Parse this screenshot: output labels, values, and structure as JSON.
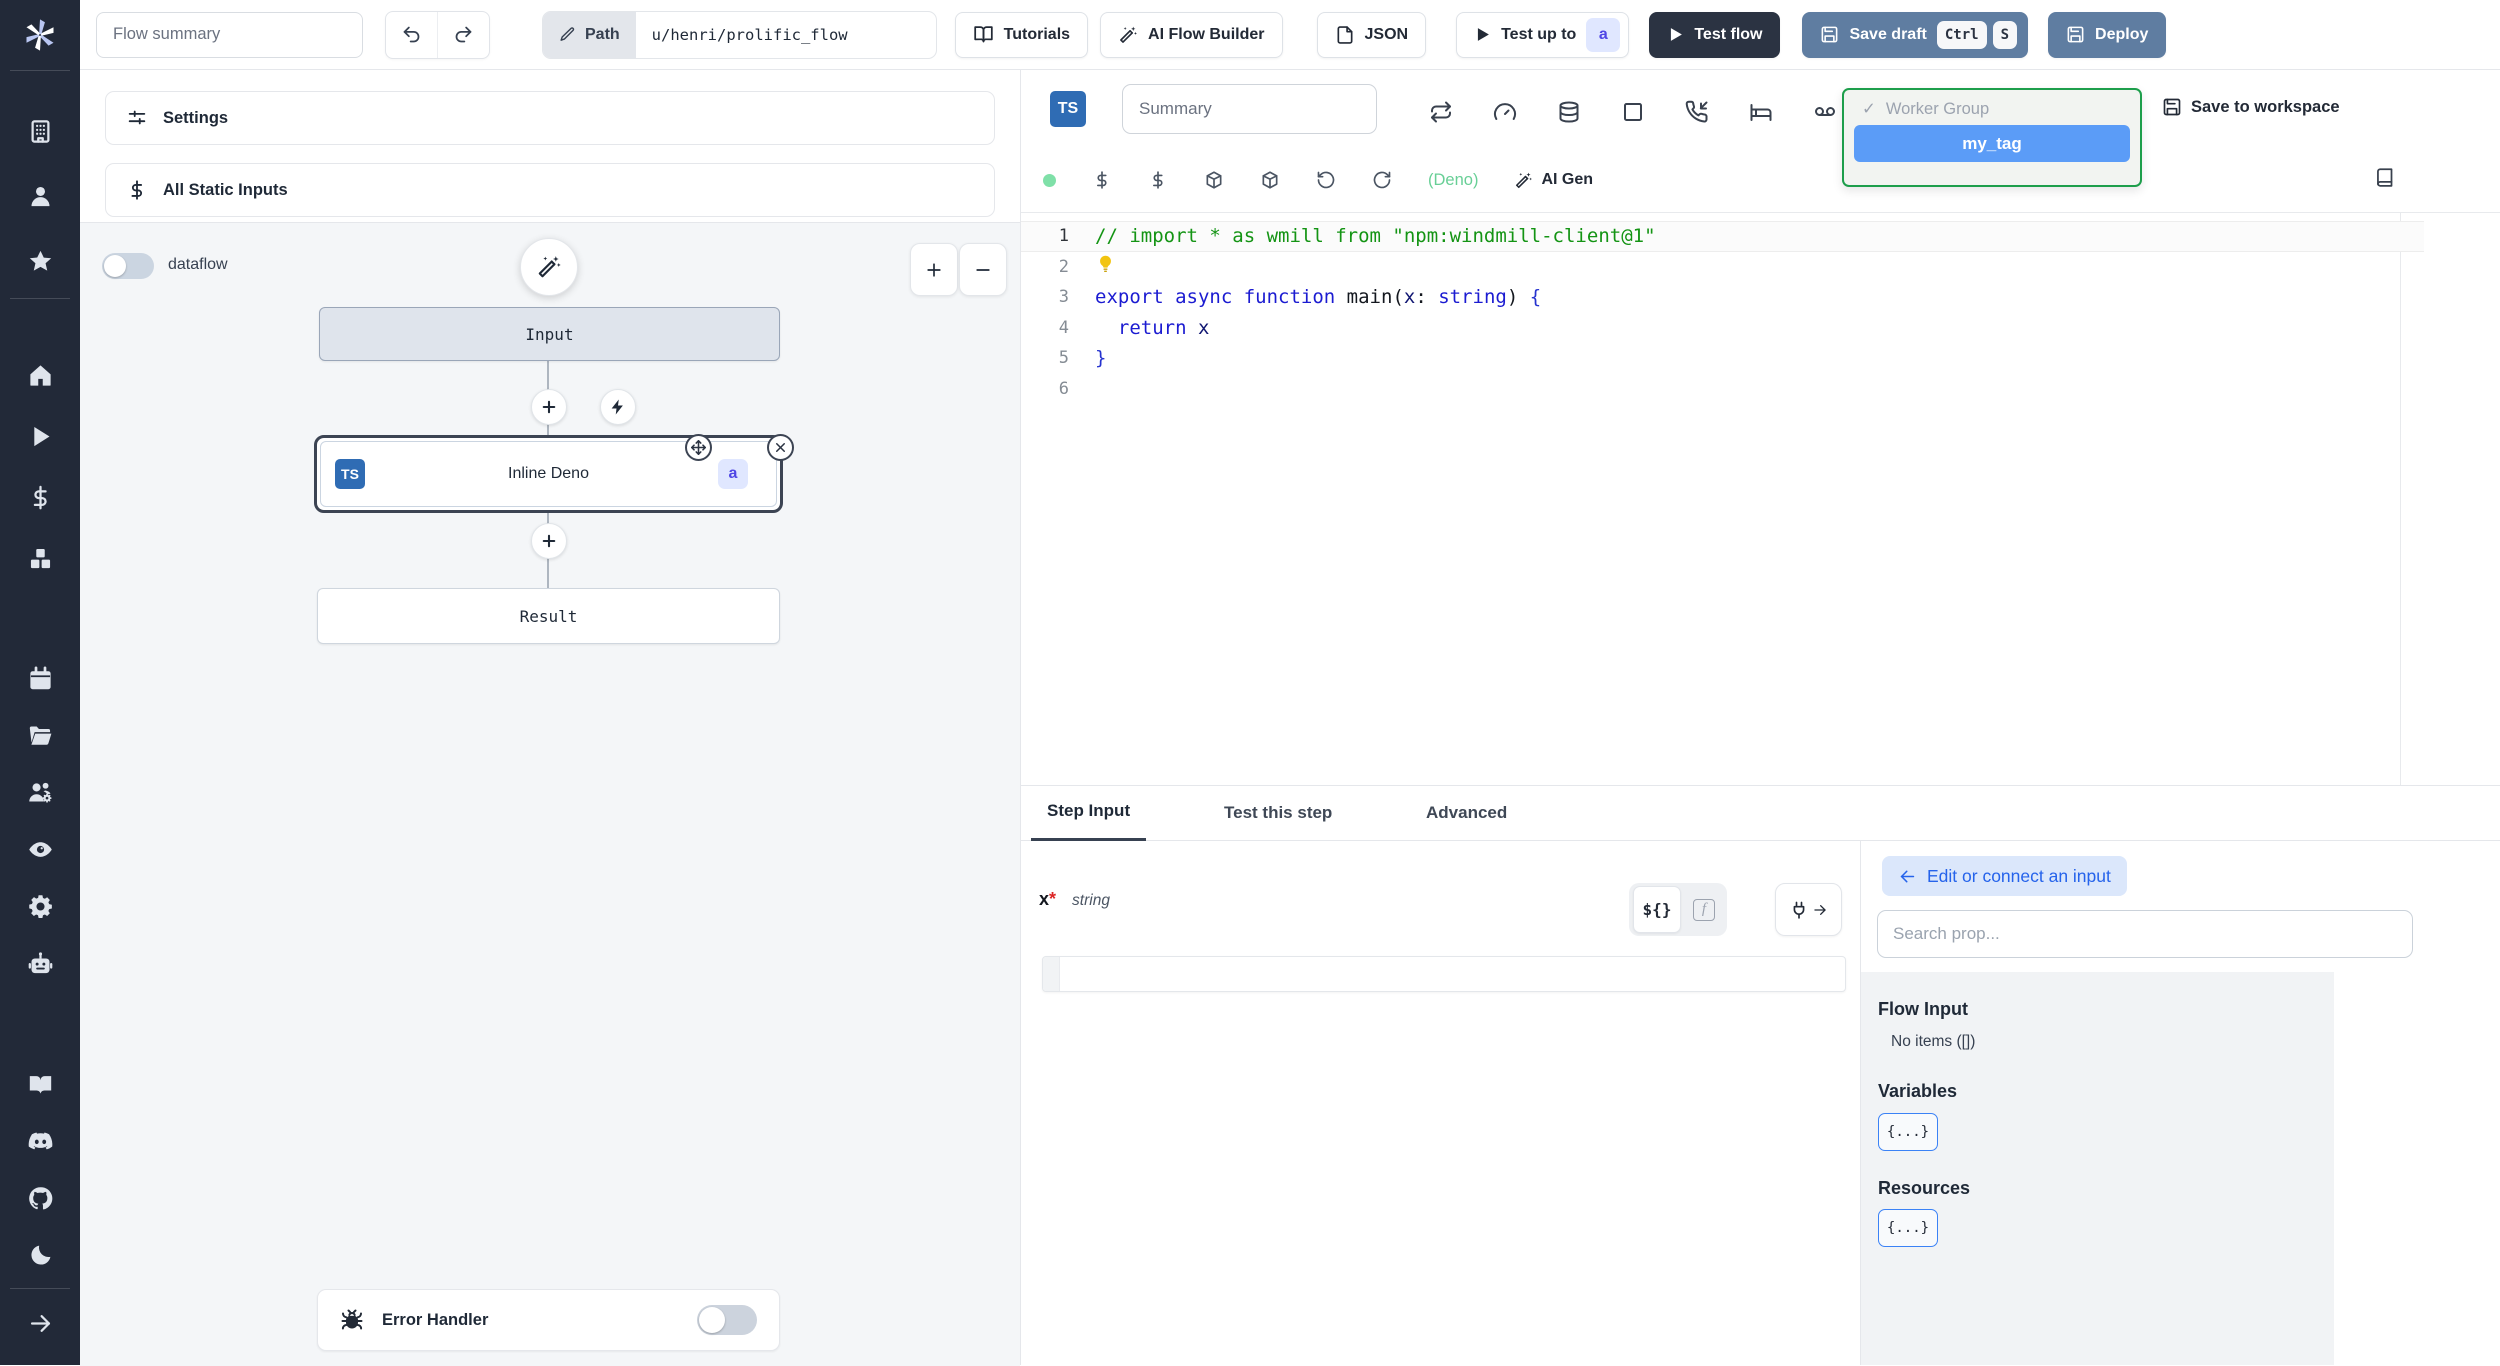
{
  "colors": {
    "sidebar_bg": "#222938",
    "button_slate": "#5f7da1",
    "button_dark": "#2b3342",
    "ts_blue": "#2f6cb4",
    "badge_indigo_bg": "#e0e7ff",
    "badge_indigo_text": "#4f46e5",
    "dropdown_green": "#1d9e4b",
    "tag_selected_bg": "#5b9cf7",
    "accent_blue": "#2563eb"
  },
  "topbar": {
    "flow_summary_placeholder": "Flow summary",
    "path_label": "Path",
    "path_value": "u/henri/prolific_flow",
    "tutorials": "Tutorials",
    "ai_flow_builder": "AI Flow Builder",
    "json": "JSON",
    "test_up_to": "Test up to",
    "test_up_to_badge": "a",
    "test_flow": "Test flow",
    "save_draft": "Save draft",
    "kbd_ctrl": "Ctrl",
    "kbd_s": "S",
    "deploy": "Deploy"
  },
  "sidebar": {
    "groups": [
      {
        "id": "account",
        "items": [
          "building",
          "user",
          "star"
        ]
      },
      {
        "id": "primary",
        "items": [
          "home",
          "play",
          "dollar",
          "boxes"
        ]
      },
      {
        "id": "workspace",
        "items": [
          "calendar",
          "folder-open",
          "users-cog",
          "eye",
          "gear",
          "bot"
        ]
      },
      {
        "id": "help",
        "items": [
          "docs",
          "discord",
          "github",
          "moon"
        ]
      },
      {
        "id": "footer",
        "items": [
          "arrow-right"
        ]
      }
    ]
  },
  "flow_panel": {
    "settings_label": "Settings",
    "static_inputs_label": "All Static Inputs",
    "dataflow_label": "dataflow",
    "input_node": "Input",
    "step_node_label": "Inline Deno",
    "step_node_lang_badge": "TS",
    "step_node_id_badge": "a",
    "result_node": "Result",
    "error_handler_label": "Error Handler"
  },
  "editor_panel": {
    "lang_badge": "TS",
    "summary_placeholder": "Summary",
    "step_setting_icons": [
      "repeat",
      "gauge",
      "database",
      "square",
      "phone-incoming",
      "bed",
      "voicemail"
    ],
    "quick_icons": [
      "dollar",
      "dollar",
      "box",
      "box",
      "rotate-ccw",
      "refresh-cw"
    ],
    "deno_label": "(Deno)",
    "ai_gen_label": "AI Gen",
    "worker_group": {
      "check": "✓",
      "label": "Worker Group",
      "options": [
        "my_tag"
      ],
      "selected_option": "my_tag"
    },
    "save_to_workspace": "Save to workspace",
    "code": {
      "lines": [
        {
          "num": "1",
          "highlight": true,
          "tokens": [
            [
              "// import * as wmill from \"npm:windmill-client@1\"",
              "comment"
            ]
          ]
        },
        {
          "num": "2",
          "bulb": true,
          "tokens": []
        },
        {
          "num": "3",
          "tokens": [
            [
              "export ",
              "kw"
            ],
            [
              "async ",
              "kw"
            ],
            [
              "function ",
              "kw"
            ],
            [
              "main",
              "fn"
            ],
            [
              "(",
              "pu"
            ],
            [
              "x",
              "vr"
            ],
            [
              ": ",
              "pu"
            ],
            [
              "string",
              "kw"
            ],
            [
              ")",
              "pu"
            ],
            [
              " {",
              "br"
            ]
          ]
        },
        {
          "num": "4",
          "tokens": [
            [
              "  ",
              "pu"
            ],
            [
              "return",
              "kw"
            ],
            [
              " x",
              "vr"
            ]
          ]
        },
        {
          "num": "5",
          "tokens": [
            [
              "}",
              "br"
            ]
          ]
        },
        {
          "num": "6",
          "tokens": []
        }
      ]
    }
  },
  "bottom_panel": {
    "tabs": [
      "Step Input",
      "Test this step",
      "Advanced"
    ],
    "active_tab": "Step Input",
    "field": {
      "name": "x",
      "required_mark": "*",
      "type": "string"
    },
    "expr_toggle_label": "${}",
    "fn_toggle_label": "f",
    "prop_picker": {
      "connect_label": "Edit or connect an input",
      "search_placeholder": "Search prop...",
      "flow_input_title": "Flow Input",
      "flow_input_empty": "No items ([])",
      "variables_title": "Variables",
      "variables_chip": "{...}",
      "resources_title": "Resources",
      "resources_chip": "{...}"
    }
  }
}
